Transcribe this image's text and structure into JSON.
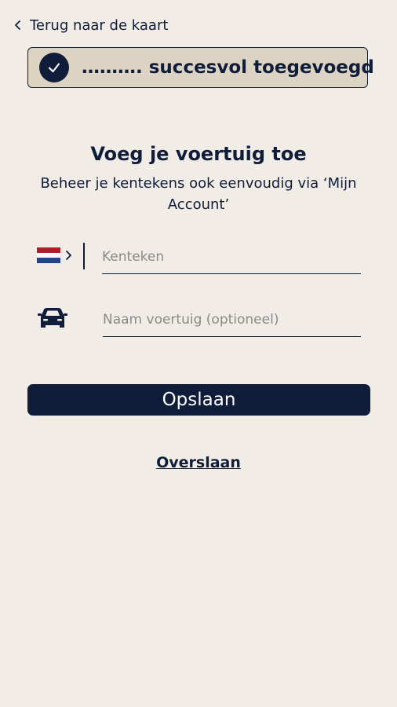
{
  "header": {
    "back_label": "Terug naar de kaart",
    "back_icon": "chevron-left-icon"
  },
  "toast": {
    "message": "………. succesvol toegevoegd",
    "icon": "check-circle-icon"
  },
  "form": {
    "title": "Voeg je voertuig toe",
    "subtitle": "Beheer je kentekens ook eenvoudig via ‘Mijn Account’",
    "country": {
      "icon": "netherlands-flag-icon",
      "flag_colors": [
        "#ae1c28",
        "#ffffff",
        "#21468b"
      ]
    },
    "plate": {
      "value": "",
      "placeholder": "Kenteken"
    },
    "vehicle_name": {
      "icon": "car-icon",
      "value": "",
      "placeholder": "Naam voertuig (optioneel)"
    },
    "save_label": "Opslaan",
    "skip_label": "Overslaan"
  },
  "colors": {
    "background": "#f1ede6",
    "primary": "#0f1c3a",
    "toast_background": "#ddd3c3"
  }
}
